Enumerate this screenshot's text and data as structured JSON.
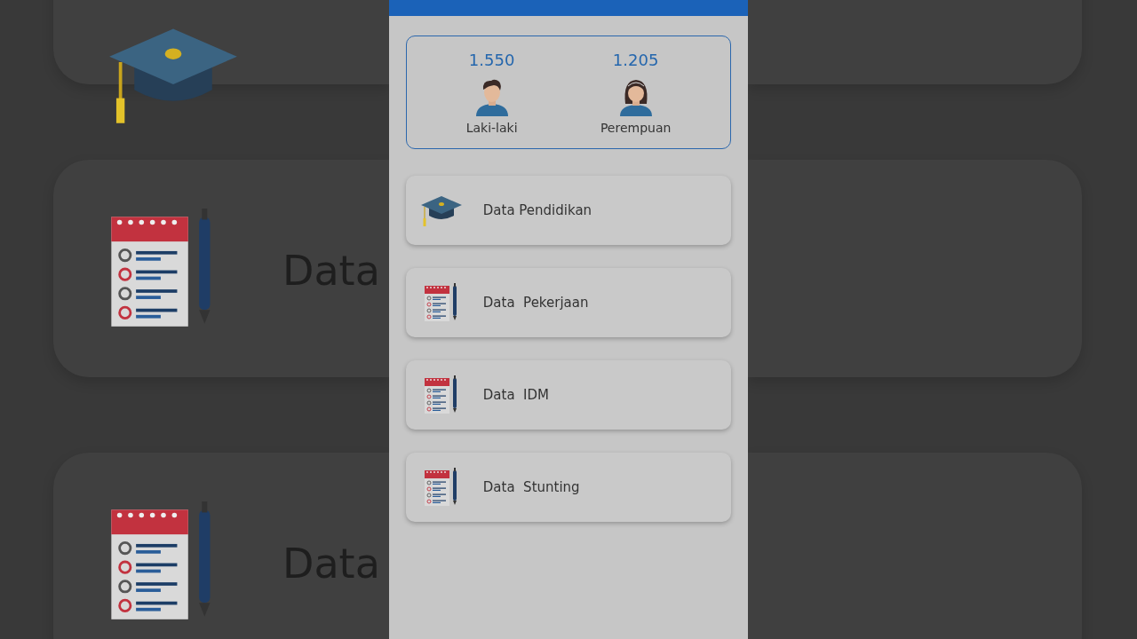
{
  "backdrop": {
    "cards": [
      {
        "kind": "cap"
      },
      {
        "kind": "notepad",
        "label": "Data"
      },
      {
        "kind": "notepad",
        "label": "Data"
      }
    ]
  },
  "stats": [
    {
      "kind": "male",
      "value": "1.550",
      "label": "Laki-laki"
    },
    {
      "kind": "female",
      "value": "1.205",
      "label": "Perempuan"
    }
  ],
  "menu": [
    {
      "kind": "cap",
      "label": "Data Pendidikan"
    },
    {
      "kind": "notepad",
      "label": "Data  Pekerjaan"
    },
    {
      "kind": "notepad",
      "label": "Data  IDM"
    },
    {
      "kind": "notepad",
      "label": "Data  Stunting"
    }
  ]
}
